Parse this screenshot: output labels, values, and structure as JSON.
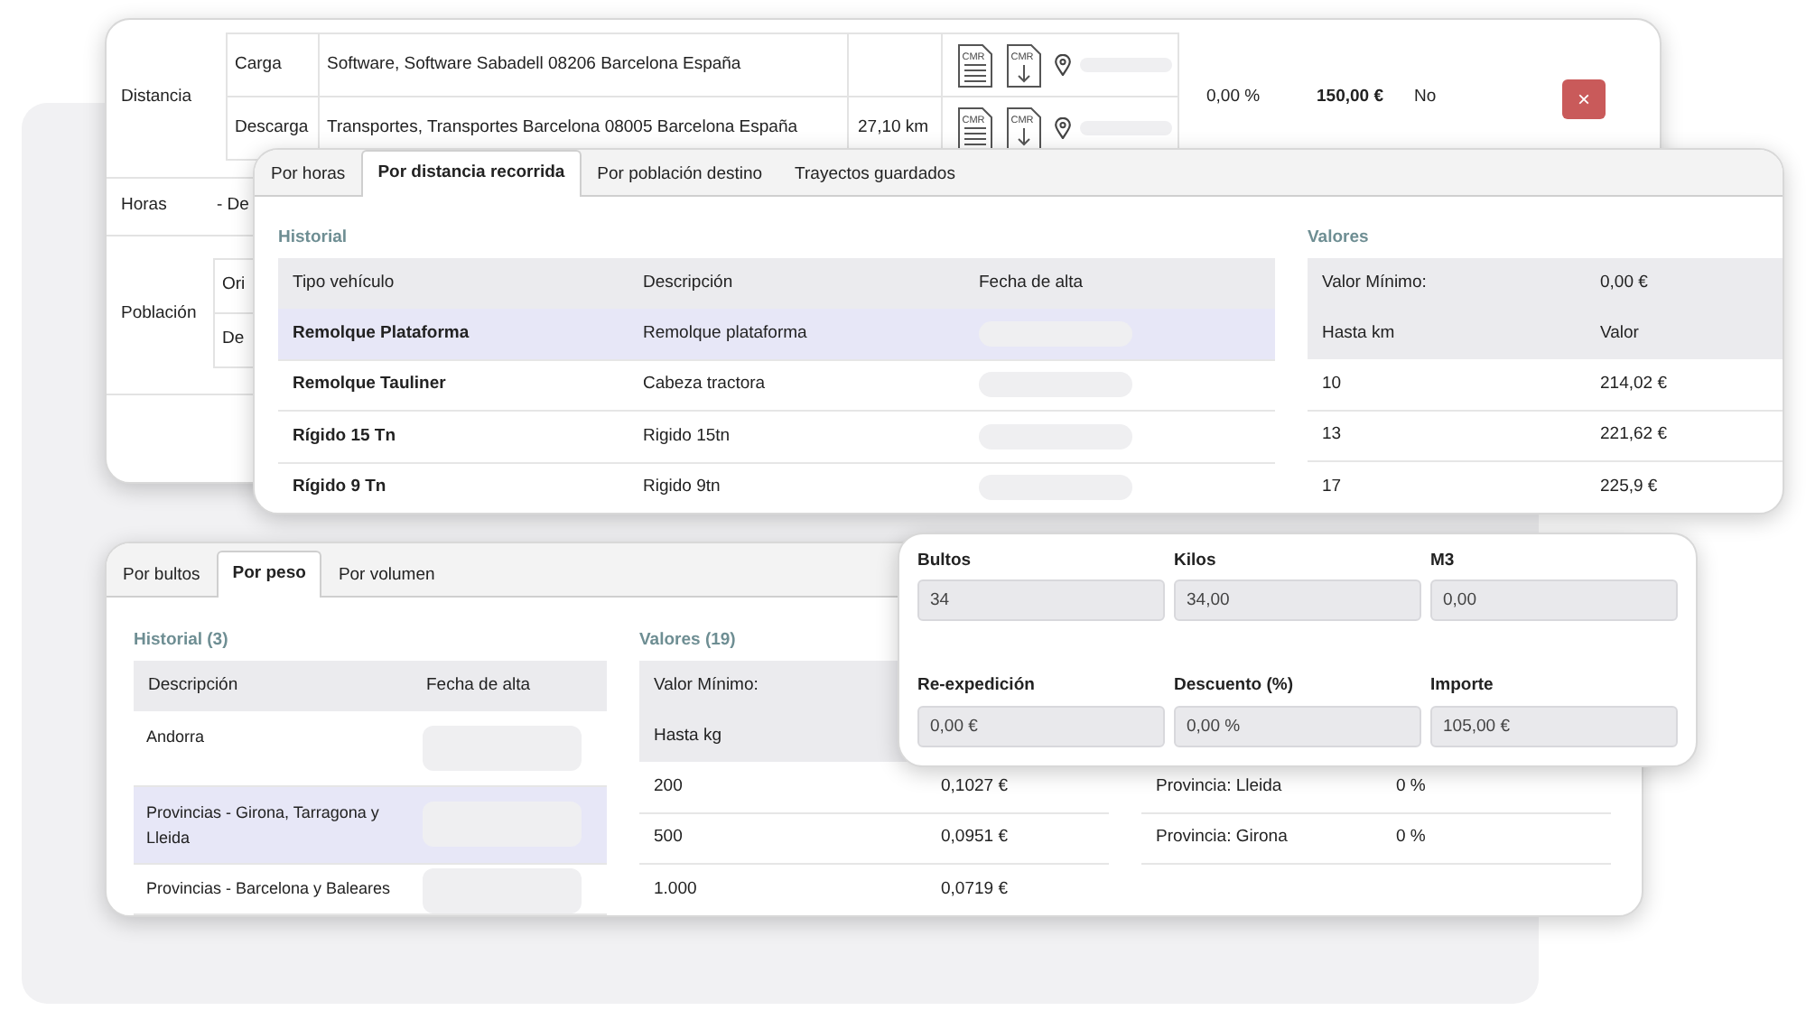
{
  "route_card": {
    "rows": [
      {
        "kind": "distance",
        "label": "Distancia",
        "legs": [
          {
            "type": "Carga",
            "address": "Software, Software Sabadell 08206 Barcelona España",
            "documents": [
              {
                "kind": "document",
                "label": "CMR"
              },
              {
                "kind": "download",
                "label": "CMR"
              }
            ]
          },
          {
            "type": "Descarga",
            "address": "Transportes, Transportes Barcelona 08005 Barcelona España",
            "distance": "27,10 km",
            "documents": [
              {
                "kind": "document",
                "label": "CMR"
              },
              {
                "kind": "download",
                "label": "CMR"
              }
            ]
          }
        ],
        "percentage": "0,00 %",
        "amount": "150,00 €",
        "flag": "No",
        "delete": "×"
      },
      {
        "kind": "hours",
        "label": "Horas",
        "value": "- De"
      },
      {
        "kind": "population",
        "label": "Población",
        "legs": [
          "Ori",
          "De"
        ]
      }
    ]
  },
  "distance_card": {
    "tabs": [
      {
        "label": "Por horas",
        "selected": false
      },
      {
        "label": "Por distancia recorrida",
        "selected": true
      },
      {
        "label": "Por población destino",
        "selected": false
      },
      {
        "label": "Trayectos guardados",
        "selected": false
      }
    ],
    "history": {
      "title": "Historial",
      "columns": [
        "Tipo vehículo",
        "Descripción",
        "Fecha de alta"
      ],
      "rows": [
        {
          "vehicle": "Remolque Plataforma",
          "description": "Remolque plataforma",
          "selected": true
        },
        {
          "vehicle": "Remolque Tauliner",
          "description": "Cabeza tractora",
          "selected": false
        },
        {
          "vehicle": "Rígido 15 Tn",
          "description": "Rigido 15tn",
          "selected": false
        },
        {
          "vehicle": "Rígido 9 Tn",
          "description": "Rigido 9tn",
          "selected": false
        }
      ]
    },
    "values": {
      "title": "Valores",
      "minimum_label": "Valor Mínimo:",
      "minimum": "0,00 €",
      "columns": [
        "Hasta km",
        "Valor"
      ],
      "rows": [
        [
          "10",
          "214,02 €"
        ],
        [
          "13",
          "221,62 €"
        ],
        [
          "17",
          "225,9 €"
        ]
      ]
    }
  },
  "weight_card": {
    "tabs": [
      {
        "label": "Por bultos",
        "selected": false
      },
      {
        "label": "Por peso",
        "selected": true
      },
      {
        "label": "Por volumen",
        "selected": false
      }
    ],
    "history": {
      "title": "Historial (3)",
      "columns": [
        "Descripción",
        "Fecha de alta"
      ],
      "rows": [
        {
          "description": "Andorra",
          "selected": false
        },
        {
          "description": "Provincias - Girona, Tarragona y Lleida",
          "selected": true
        },
        {
          "description": "Provincias - Barcelona y Baleares",
          "selected": false
        }
      ]
    },
    "values": {
      "title": "Valores (19)",
      "minimum_label": "Valor Mínimo:",
      "columns": [
        "Hasta kg"
      ],
      "rows": [
        [
          "200",
          "0,1027 €"
        ],
        [
          "500",
          "0,0951 €"
        ],
        [
          "1.000",
          "0,0719 €"
        ]
      ]
    },
    "zones": {
      "rows": [
        [
          "Provincia: Lleida",
          "0 %"
        ],
        [
          "Provincia: Girona",
          "0 %"
        ]
      ]
    }
  },
  "totals_card": {
    "fields": [
      {
        "label": "Bultos",
        "value": "34"
      },
      {
        "label": "Kilos",
        "value": "34,00"
      },
      {
        "label": "M3",
        "value": "0,00"
      },
      {
        "label": "Re-expedición",
        "value": "0,00 €"
      },
      {
        "label": "Descuento (%)",
        "value": "0,00 %"
      },
      {
        "label": "Importe",
        "value": "105,00 €"
      }
    ]
  }
}
